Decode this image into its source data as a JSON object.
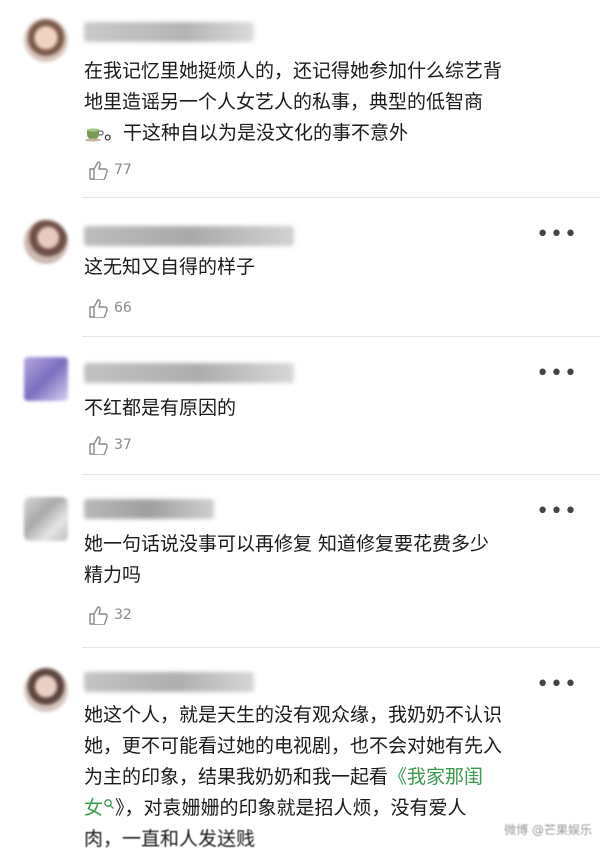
{
  "comments": [
    {
      "text_lines": [
        "在我记忆里她挺烦人的，还记得她参加什么综艺背",
        "地里造谣另一个人女艺人的私事，典型的低智商"
      ],
      "text_tail": "。干这种自以为是没文化的事不意外",
      "inline_icon": "teacup-emoji",
      "likes": "77"
    },
    {
      "text_lines": [
        "这无知又自得的样子"
      ],
      "likes": "66"
    },
    {
      "text_lines": [
        "不红都是有原因的"
      ],
      "likes": "37"
    },
    {
      "text_lines": [
        "她一句话说没事可以再修复  知道修复要花费多少",
        "精力吗"
      ],
      "likes": "32"
    },
    {
      "text_lines": [
        "她这个人，就是天生的没有观众缘，我奶奶不认识",
        "她，更不可能看过她的电视剧，也不会对她有先入",
        "为主的印象，结果我奶奶和我一起看"
      ],
      "link_text": "《我家那闺",
      "line4_link": "女",
      "line4_rest": "》，对袁姗姗的印象就是招人烦，没有爱人",
      "line5": "肉，一直和人发送贱"
    }
  ],
  "more_label": "•••",
  "watermark": "微博 @芒果娱乐",
  "colors": {
    "link": "#3a9b4b",
    "like_gray": "#8a8a8a",
    "divider": "#e6e6e6"
  }
}
